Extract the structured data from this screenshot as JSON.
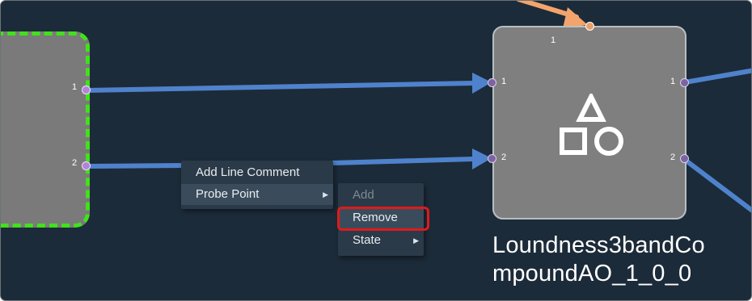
{
  "colors": {
    "canvas": "#1c2b39",
    "wire": "#4f82cc",
    "wire_input": "#f2a46c",
    "node": "#7f7f7f",
    "selection_dash": "#41e21a",
    "highlight": "#e01a1a"
  },
  "left_node": {
    "ports": [
      {
        "label": "1"
      },
      {
        "label": "2"
      }
    ]
  },
  "main_node": {
    "top_port_label": "1",
    "input_ports": [
      {
        "label": "1"
      },
      {
        "label": "2"
      }
    ],
    "output_ports": [
      {
        "label": "1"
      },
      {
        "label": "2"
      }
    ],
    "icon": "shapes-icon",
    "title_line1": "Loundness3bandCo",
    "title_line2": "mpoundAO_1_0_0"
  },
  "context_menu": {
    "items": [
      {
        "label": "Add Line Comment"
      },
      {
        "label": "Probe Point",
        "has_submenu": true
      }
    ]
  },
  "probe_submenu": {
    "items": [
      {
        "label": "Add",
        "disabled": true
      },
      {
        "label": "Remove"
      },
      {
        "label": "State",
        "has_submenu": true
      }
    ]
  }
}
